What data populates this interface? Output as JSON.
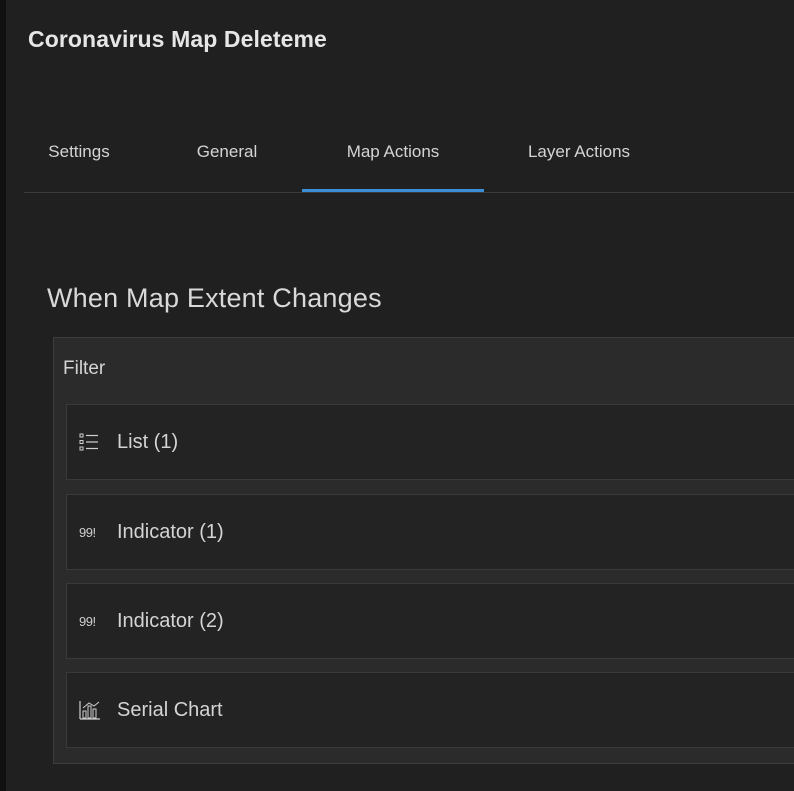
{
  "app": {
    "title": "Coronavirus Map Deleteme"
  },
  "tabs": [
    {
      "label": "Settings",
      "active": false
    },
    {
      "label": "General",
      "active": false
    },
    {
      "label": "Map Actions",
      "active": true
    },
    {
      "label": "Layer Actions",
      "active": false
    }
  ],
  "section": {
    "title": "When Map Extent Changes",
    "group_label": "Filter",
    "rows": [
      {
        "icon": "list-icon",
        "label": "List (1)"
      },
      {
        "icon": "indicator-icon",
        "icon_glyph": "99!",
        "label": "Indicator (1)"
      },
      {
        "icon": "indicator-icon",
        "icon_glyph": "99!",
        "label": "Indicator (2)"
      },
      {
        "icon": "serial-chart-icon",
        "label": "Serial Chart"
      }
    ]
  },
  "colors": {
    "accent": "#3a8fd6",
    "background": "#202020",
    "panel": "#2b2b2b",
    "row": "#232323",
    "text": "#d4d4d4"
  }
}
